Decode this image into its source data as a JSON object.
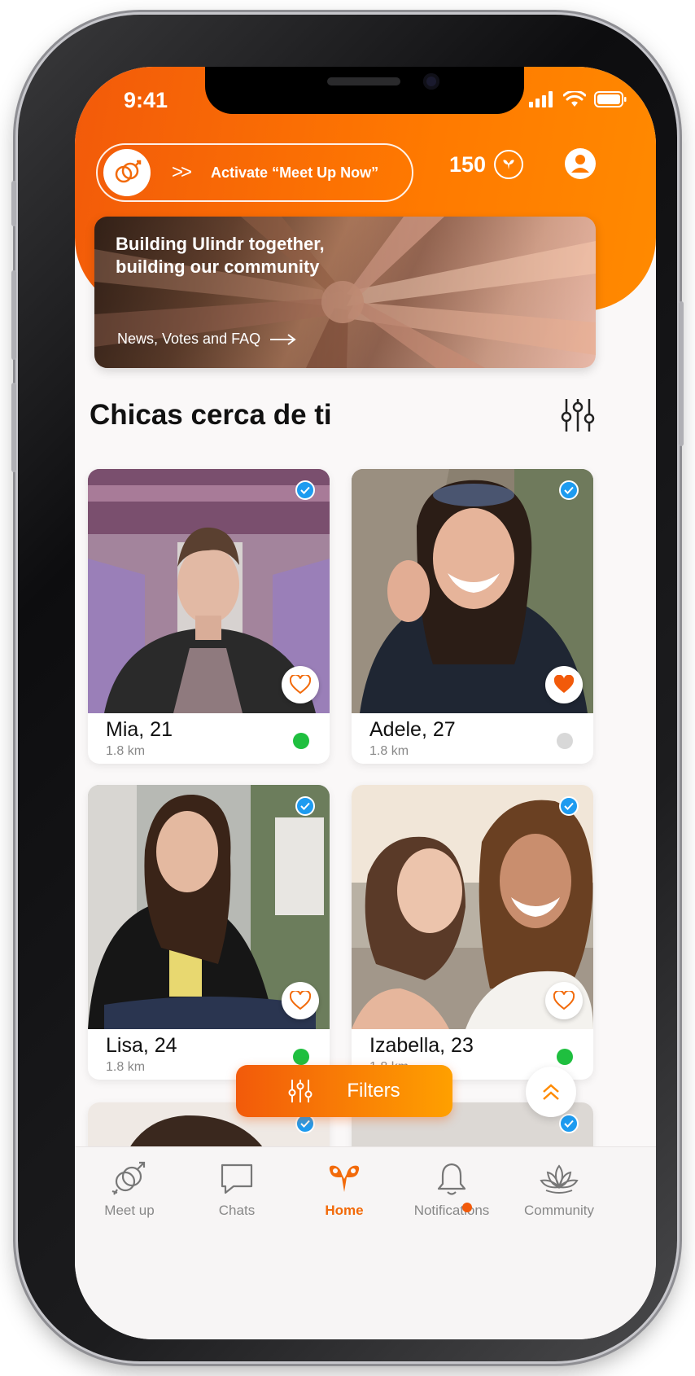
{
  "status_bar": {
    "time": "9:41"
  },
  "header": {
    "meetup_label": "Activate “Meet Up Now”",
    "coins": "150"
  },
  "banner": {
    "title": "Building Ulindr together, building our community",
    "subtitle": "News, Votes and FAQ"
  },
  "section": {
    "title": "Chicas cerca de ti"
  },
  "profiles": [
    {
      "name": "Mia, 21",
      "distance": "1.8 km",
      "online": true,
      "liked": false
    },
    {
      "name": "Adele, 27",
      "distance": "1.8 km",
      "online": false,
      "liked": true
    },
    {
      "name": "Lisa, 24",
      "distance": "1.8 km",
      "online": true,
      "liked": false
    },
    {
      "name": "Izabella, 23",
      "distance": "1.8 km",
      "online": true,
      "liked": false
    }
  ],
  "filters_button": {
    "label": "Filters"
  },
  "tabbar": {
    "tabs": [
      {
        "label": "Meet up",
        "icon": "meet-up-icon"
      },
      {
        "label": "Chats",
        "icon": "chat-bubble-icon"
      },
      {
        "label": "Home",
        "icon": "home-ram-icon",
        "active": true
      },
      {
        "label": "Notifications",
        "icon": "bell-icon"
      },
      {
        "label": "Community",
        "icon": "lotus-icon"
      }
    ]
  },
  "colors": {
    "accent": "#f25a0a",
    "accent_light": "#ff8a00",
    "online": "#1fbf3f",
    "offline": "#d8d8d8",
    "verified": "#1d9bf0"
  }
}
